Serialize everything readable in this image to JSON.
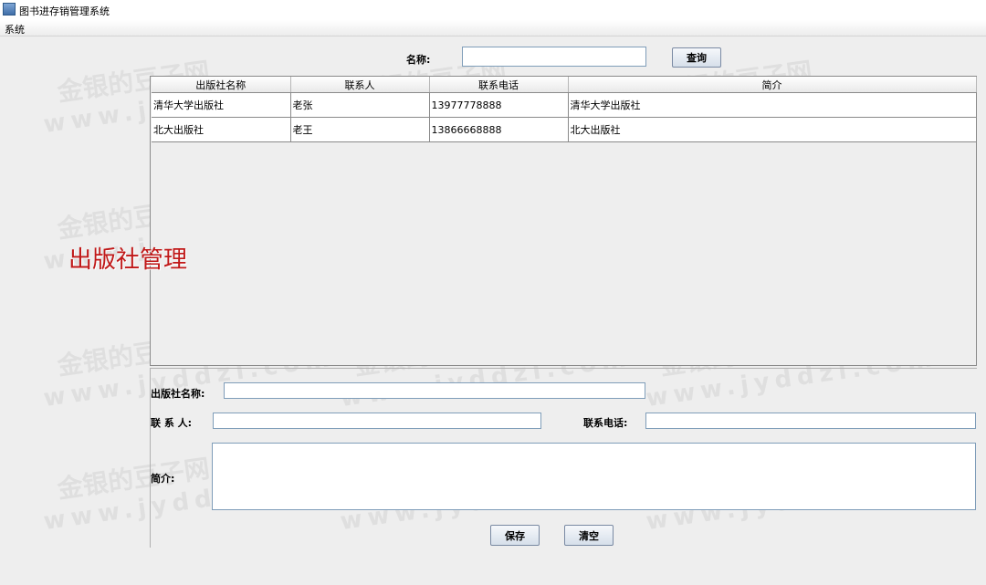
{
  "window": {
    "title": "图书进存销管理系统"
  },
  "menu": {
    "items": [
      "系统"
    ]
  },
  "search": {
    "label": "名称:",
    "value": "",
    "button": "查询"
  },
  "table": {
    "columns": [
      "出版社名称",
      "联系人",
      "联系电话",
      "简介"
    ],
    "rows": [
      [
        "清华大学出版社",
        "老张",
        "13977778888",
        "清华大学出版社"
      ],
      [
        "北大出版社",
        "老王",
        "13866668888",
        "北大出版社"
      ]
    ]
  },
  "heading": "出版社管理",
  "form": {
    "name_label": "出版社名称:",
    "name_value": "",
    "contact_label": "联 系 人:",
    "contact_value": "",
    "phone_label": "联系电话:",
    "phone_value": "",
    "remark_label": "简介:",
    "remark_value": "",
    "save_button": "保存",
    "clear_button": "清空"
  },
  "watermark": {
    "cn": "金银的豆子网",
    "en": "www.jyddzi.com"
  },
  "colors": {
    "heading": "#c01818",
    "field_border": "#7f9db9",
    "window_bg": "#eeeeee"
  }
}
